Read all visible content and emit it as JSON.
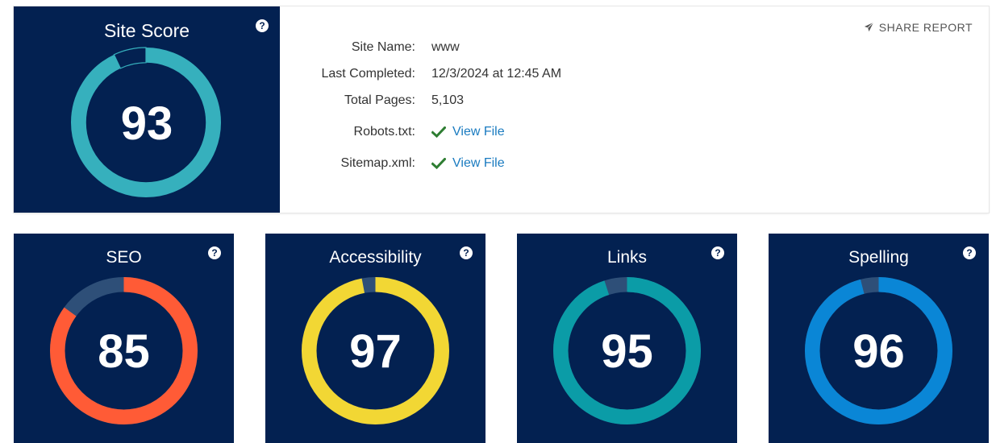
{
  "site_score": {
    "title": "Site Score",
    "value": "93",
    "percent": 93,
    "color": "#36b0bd",
    "help": "?"
  },
  "details": {
    "rows": [
      {
        "label": "Site Name:",
        "value": "www"
      },
      {
        "label": "Last Completed:",
        "value": "12/3/2024 at 12:45 AM"
      },
      {
        "label": "Total Pages:",
        "value": "5,103"
      },
      {
        "label": "Robots.txt:",
        "link": "View File",
        "icon": "check-icon"
      },
      {
        "label": "Sitemap.xml:",
        "link": "View File",
        "icon": "check-icon"
      }
    ],
    "check_color": "#2e7d32",
    "link_color": "#1a7bc0"
  },
  "share": {
    "label": "SHARE REPORT",
    "icon": "paper-plane-icon"
  },
  "categories": [
    {
      "title": "SEO",
      "value": "85",
      "percent": 85,
      "color": "#ff5b36",
      "help": "?"
    },
    {
      "title": "Accessibility",
      "value": "97",
      "percent": 97,
      "color": "#f2d734",
      "help": "?"
    },
    {
      "title": "Links",
      "value": "95",
      "percent": 95,
      "color": "#0b9ca7",
      "help": "?"
    },
    {
      "title": "Spelling",
      "value": "96",
      "percent": 96,
      "color": "#0a86d6",
      "help": "?"
    }
  ],
  "colors": {
    "panel_bg": "#032151",
    "track": "#2e4f78"
  }
}
